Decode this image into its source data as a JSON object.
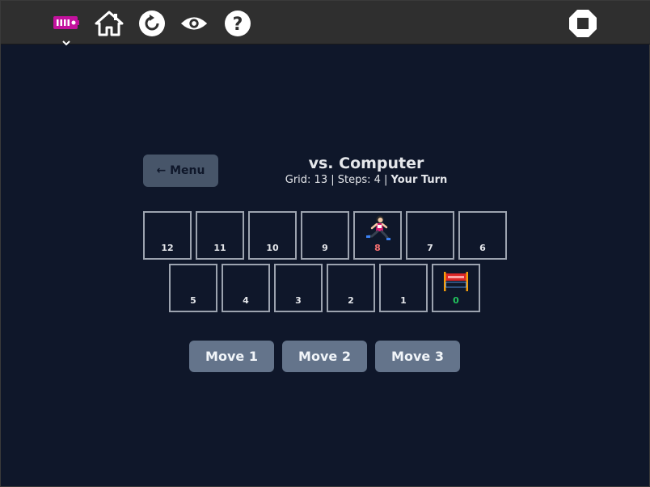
{
  "toolbar": {
    "icons": [
      "activity-icon",
      "home-icon",
      "refresh-icon",
      "view-icon",
      "help-icon",
      "stop-icon"
    ]
  },
  "game": {
    "menu_label": "← Menu",
    "title": "vs. Computer",
    "status_prefix": "Grid: 13 | Steps: 4 | ",
    "status_turn": "Your Turn"
  },
  "board": {
    "row1": [
      "12",
      "11",
      "10",
      "9",
      "8",
      "7",
      "6"
    ],
    "row2": [
      "5",
      "4",
      "3",
      "2",
      "1",
      "0"
    ],
    "current_position": "8",
    "goal_position": "0"
  },
  "moves": [
    "Move 1",
    "Move 2",
    "Move 3"
  ],
  "colors": {
    "background": "#0f172a",
    "toolbar": "#2f2f2f",
    "cell_border": "#9ca3af",
    "current_number": "#f87171",
    "goal_number": "#22c55e",
    "move_button": "#64748b",
    "menu_button": "#475569"
  }
}
